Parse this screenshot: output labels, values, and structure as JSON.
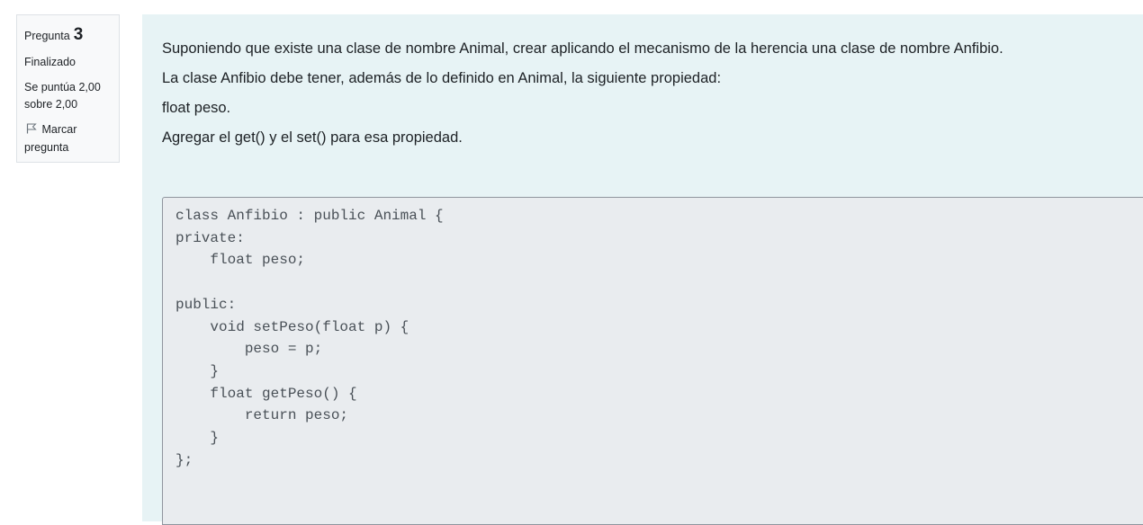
{
  "info": {
    "question_label": "Pregunta",
    "question_number": "3",
    "state": "Finalizado",
    "grade_line1": "Se puntúa 2,00",
    "grade_line2": "sobre 2,00",
    "flag_label_line1": "Marcar",
    "flag_label_line2": "pregunta",
    "flag_icon": "flag-outline-icon"
  },
  "question": {
    "paragraphs": [
      "Suponiendo que existe una clase de nombre Animal, crear aplicando el mecanismo de la herencia una clase de nombre Anfibio.",
      "La clase Anfibio debe tener, además de lo definido en Animal, la siguiente propiedad:",
      "float peso.",
      "Agregar el get() y el set() para esa propiedad."
    ]
  },
  "answer": {
    "code": "class Anfibio : public Animal {\nprivate:\n    float peso;\n\npublic:\n    void setPeso(float p) {\n        peso = p;\n    }\n    float getPeso() {\n        return peso;\n    }\n};"
  },
  "colors": {
    "content_bg": "#e7f3f5",
    "answer_bg": "#e9ecef",
    "info_bg": "#f8f9fa"
  }
}
